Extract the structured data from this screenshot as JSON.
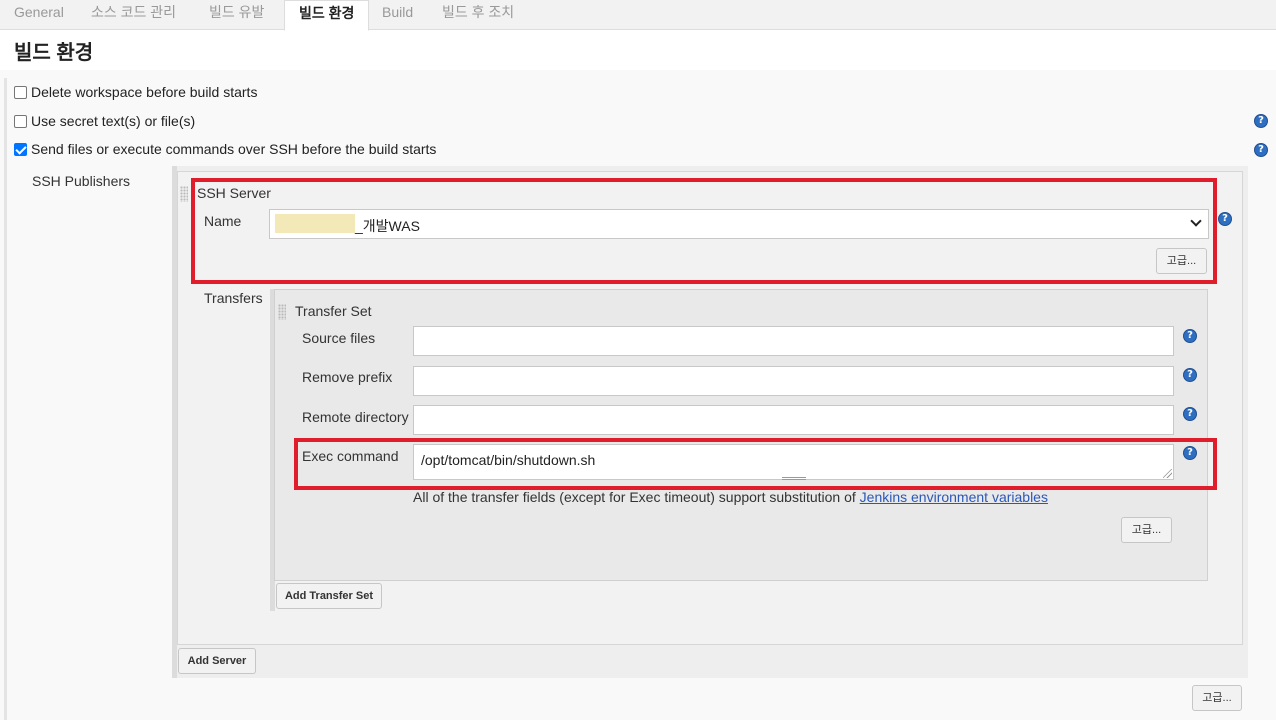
{
  "tabs": [
    "General",
    "소스 코드 관리",
    "빌드 유발",
    "빌드 환경",
    "Build",
    "빌드 후 조치"
  ],
  "section_title": "빌드 환경",
  "options": [
    {
      "label": "Delete workspace before build starts",
      "checked": false
    },
    {
      "label": "Use secret text(s) or file(s)",
      "checked": false
    },
    {
      "label": "Send files or execute commands over SSH before the build starts",
      "checked": true
    }
  ],
  "ssh": {
    "publishers_label": "SSH Publishers",
    "server_title": "SSH Server",
    "name_label": "Name",
    "name_value": "_개발WAS",
    "advanced_label": "고급...",
    "transfers_label": "Transfers",
    "transfer_set_title": "Transfer Set",
    "fields": {
      "source_files": {
        "label": "Source files",
        "value": ""
      },
      "remove_prefix": {
        "label": "Remove prefix",
        "value": ""
      },
      "remote_directory": {
        "label": "Remote directory",
        "value": ""
      },
      "exec_command": {
        "label": "Exec command",
        "value": "/opt/tomcat/bin/shutdown.sh"
      }
    },
    "note_text": "All of the transfer fields (except for Exec timeout) support substitution of ",
    "note_link": "Jenkins environment variables",
    "transfer_advanced_label": "고급...",
    "add_transfer_set": "Add Transfer Set",
    "add_server": "Add Server",
    "bottom_advanced_label": "고급..."
  },
  "help_icon_glyph": "?",
  "colors": {
    "highlight_border": "#e01e2b",
    "link": "#2b58b8",
    "checkbox": "#0075ff"
  }
}
